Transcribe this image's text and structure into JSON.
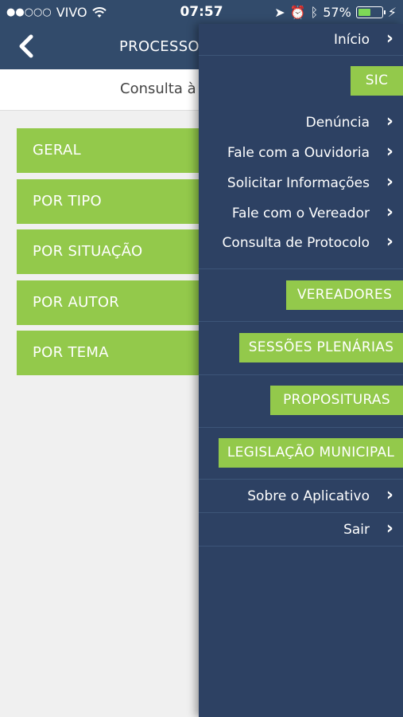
{
  "status": {
    "carrier": "VIVO",
    "time": "07:57",
    "battery": "57%",
    "battery_level": 0.57
  },
  "nav": {
    "title": "PROCESSO"
  },
  "subheader": {
    "text": "Consulta à"
  },
  "buttons": [
    "GERAL",
    "POR TIPO",
    "POR SITUAÇÃO",
    "POR AUTOR",
    "POR TEMA"
  ],
  "drawer": {
    "inicio": "Início",
    "sic": "SIC",
    "sic_items": [
      "Denúncia",
      "Fale com a Ouvidoria",
      "Solicitar Informações",
      "Fale com o Vereador",
      "Consulta de Protocolo"
    ],
    "vereadores": "VEREADORES",
    "sessoes": "SESSÕES PLENÁRIAS",
    "proposituras": "PROPOSITURAS",
    "legislacao": "LEGISLAÇÃO MUNICIPAL",
    "sobre": "Sobre o Aplicativo",
    "sair": "Sair"
  }
}
